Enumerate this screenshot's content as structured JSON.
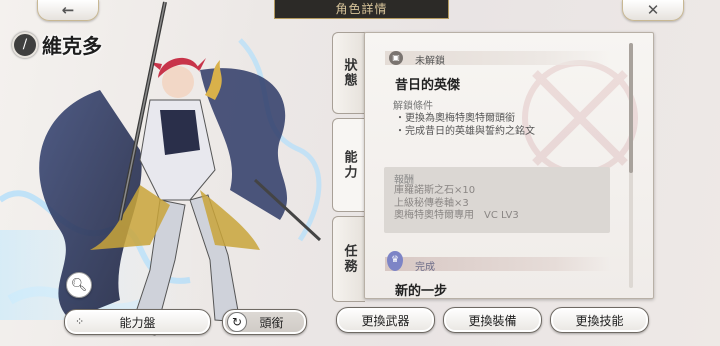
{
  "header": {
    "title": "角色詳情",
    "back_icon": "back-arrow-icon",
    "close_icon": "close-icon"
  },
  "character": {
    "name": "維克多",
    "class_icon": "sword-class-icon"
  },
  "tabs": [
    {
      "label": "狀態"
    },
    {
      "label": "能力"
    },
    {
      "label": "任務"
    }
  ],
  "achievement": {
    "status": "未解鎖",
    "title": "昔日的英傑",
    "conditions_label": "解鎖條件",
    "conditions": [
      "・更換為奧梅特奧特爾頭銜",
      "・完成昔日的英雄與誓約之銘文"
    ],
    "reward_label": "報酬",
    "rewards": [
      "庫羅諾斯之石×10",
      "上級秘傳卷軸×3",
      "奧梅特奧特爾專用　VC LV3"
    ]
  },
  "next_entry": {
    "status": "完成",
    "title": "新的一步"
  },
  "buttons": {
    "ability_board": "能力盤",
    "title": "頭銜",
    "change_weapon": "更換武器",
    "change_gear": "更換裝備",
    "change_skill": "更換技能"
  },
  "colors": {
    "accent_gold": "#b49a5e",
    "complete_badge": "#7d84c6",
    "locked_badge": "#7a7470"
  }
}
